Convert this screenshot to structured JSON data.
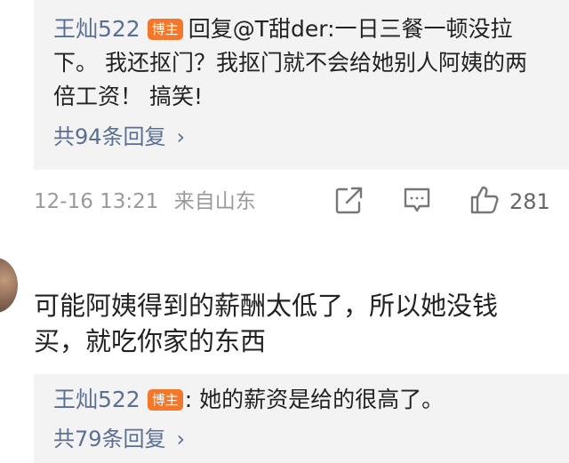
{
  "reply_block_1": {
    "username": "王灿522",
    "badge": "博主",
    "text": "回复@T甜der:一日三餐一顿没拉下。 我还抠门？我抠门就不会给她别人阿姨的两倍工资！ 搞笑!",
    "more_replies": "共94条回复",
    "chevron": "›"
  },
  "comment_meta": {
    "datetime": "12-16 13:21",
    "source": "来自山东",
    "like_count": "281"
  },
  "icons": [
    "share-icon",
    "comment-icon",
    "like-icon",
    "avatar"
  ],
  "comment_2": {
    "text": "可能阿姨得到的薪酬太低了，所以她没钱买，就吃你家的东西"
  },
  "reply_block_2": {
    "username": "王灿522",
    "badge": "博主",
    "text": ": 她的薪资是给的很高了。",
    "more_replies": "共79条回复",
    "chevron": "›"
  },
  "colors": {
    "link_blue": "#5b6f93",
    "badge_orange": "#f5772a",
    "reply_bg": "#f3f3f3",
    "meta_gray": "#9a9a9a"
  }
}
